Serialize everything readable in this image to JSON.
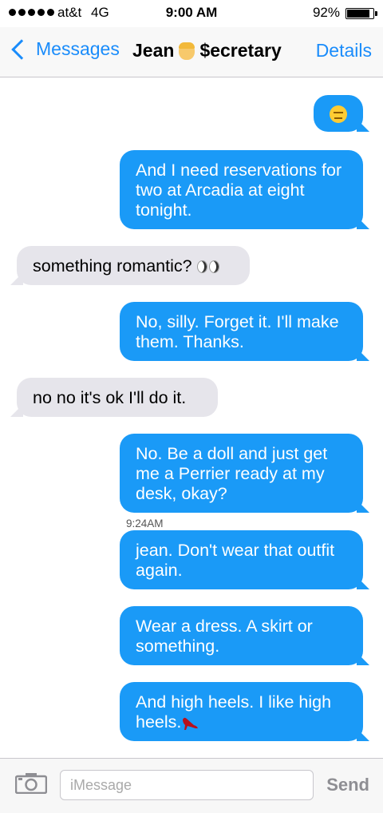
{
  "status_bar": {
    "carrier": "at&t",
    "network": "4G",
    "time": "9:00 AM",
    "battery": "92%"
  },
  "nav": {
    "back_label": "Messages",
    "title_first": "Jean",
    "title_last": "$ecretary",
    "details_label": "Details"
  },
  "messages": [
    {
      "direction": "outgoing",
      "text": "",
      "emoji": "expressionless-face"
    },
    {
      "direction": "outgoing",
      "text": "And I need reservations for two at Arcadia at eight tonight."
    },
    {
      "direction": "incoming",
      "text": "something romantic? ",
      "emoji": "eyes"
    },
    {
      "direction": "outgoing",
      "text": "No, silly. Forget it. I'll make them. Thanks."
    },
    {
      "direction": "incoming",
      "text": "no no it's ok I'll do it."
    },
    {
      "direction": "outgoing",
      "text": "No. Be a doll and just get me a Perrier ready at my desk, okay?"
    },
    {
      "direction": "outgoing",
      "text": "jean. Don't wear that outfit again."
    },
    {
      "direction": "outgoing",
      "text": "Wear a dress. A skirt or something."
    },
    {
      "direction": "outgoing",
      "text": "And high heels. I like high heels.",
      "emoji": "high-heel"
    }
  ],
  "timestamp": "9:24AM",
  "input": {
    "placeholder": "iMessage",
    "value": "",
    "send_label": "Send"
  },
  "colors": {
    "accent": "#1a8cfb",
    "outgoing_bubble": "#1a9af7",
    "incoming_bubble": "#e6e5eb"
  }
}
